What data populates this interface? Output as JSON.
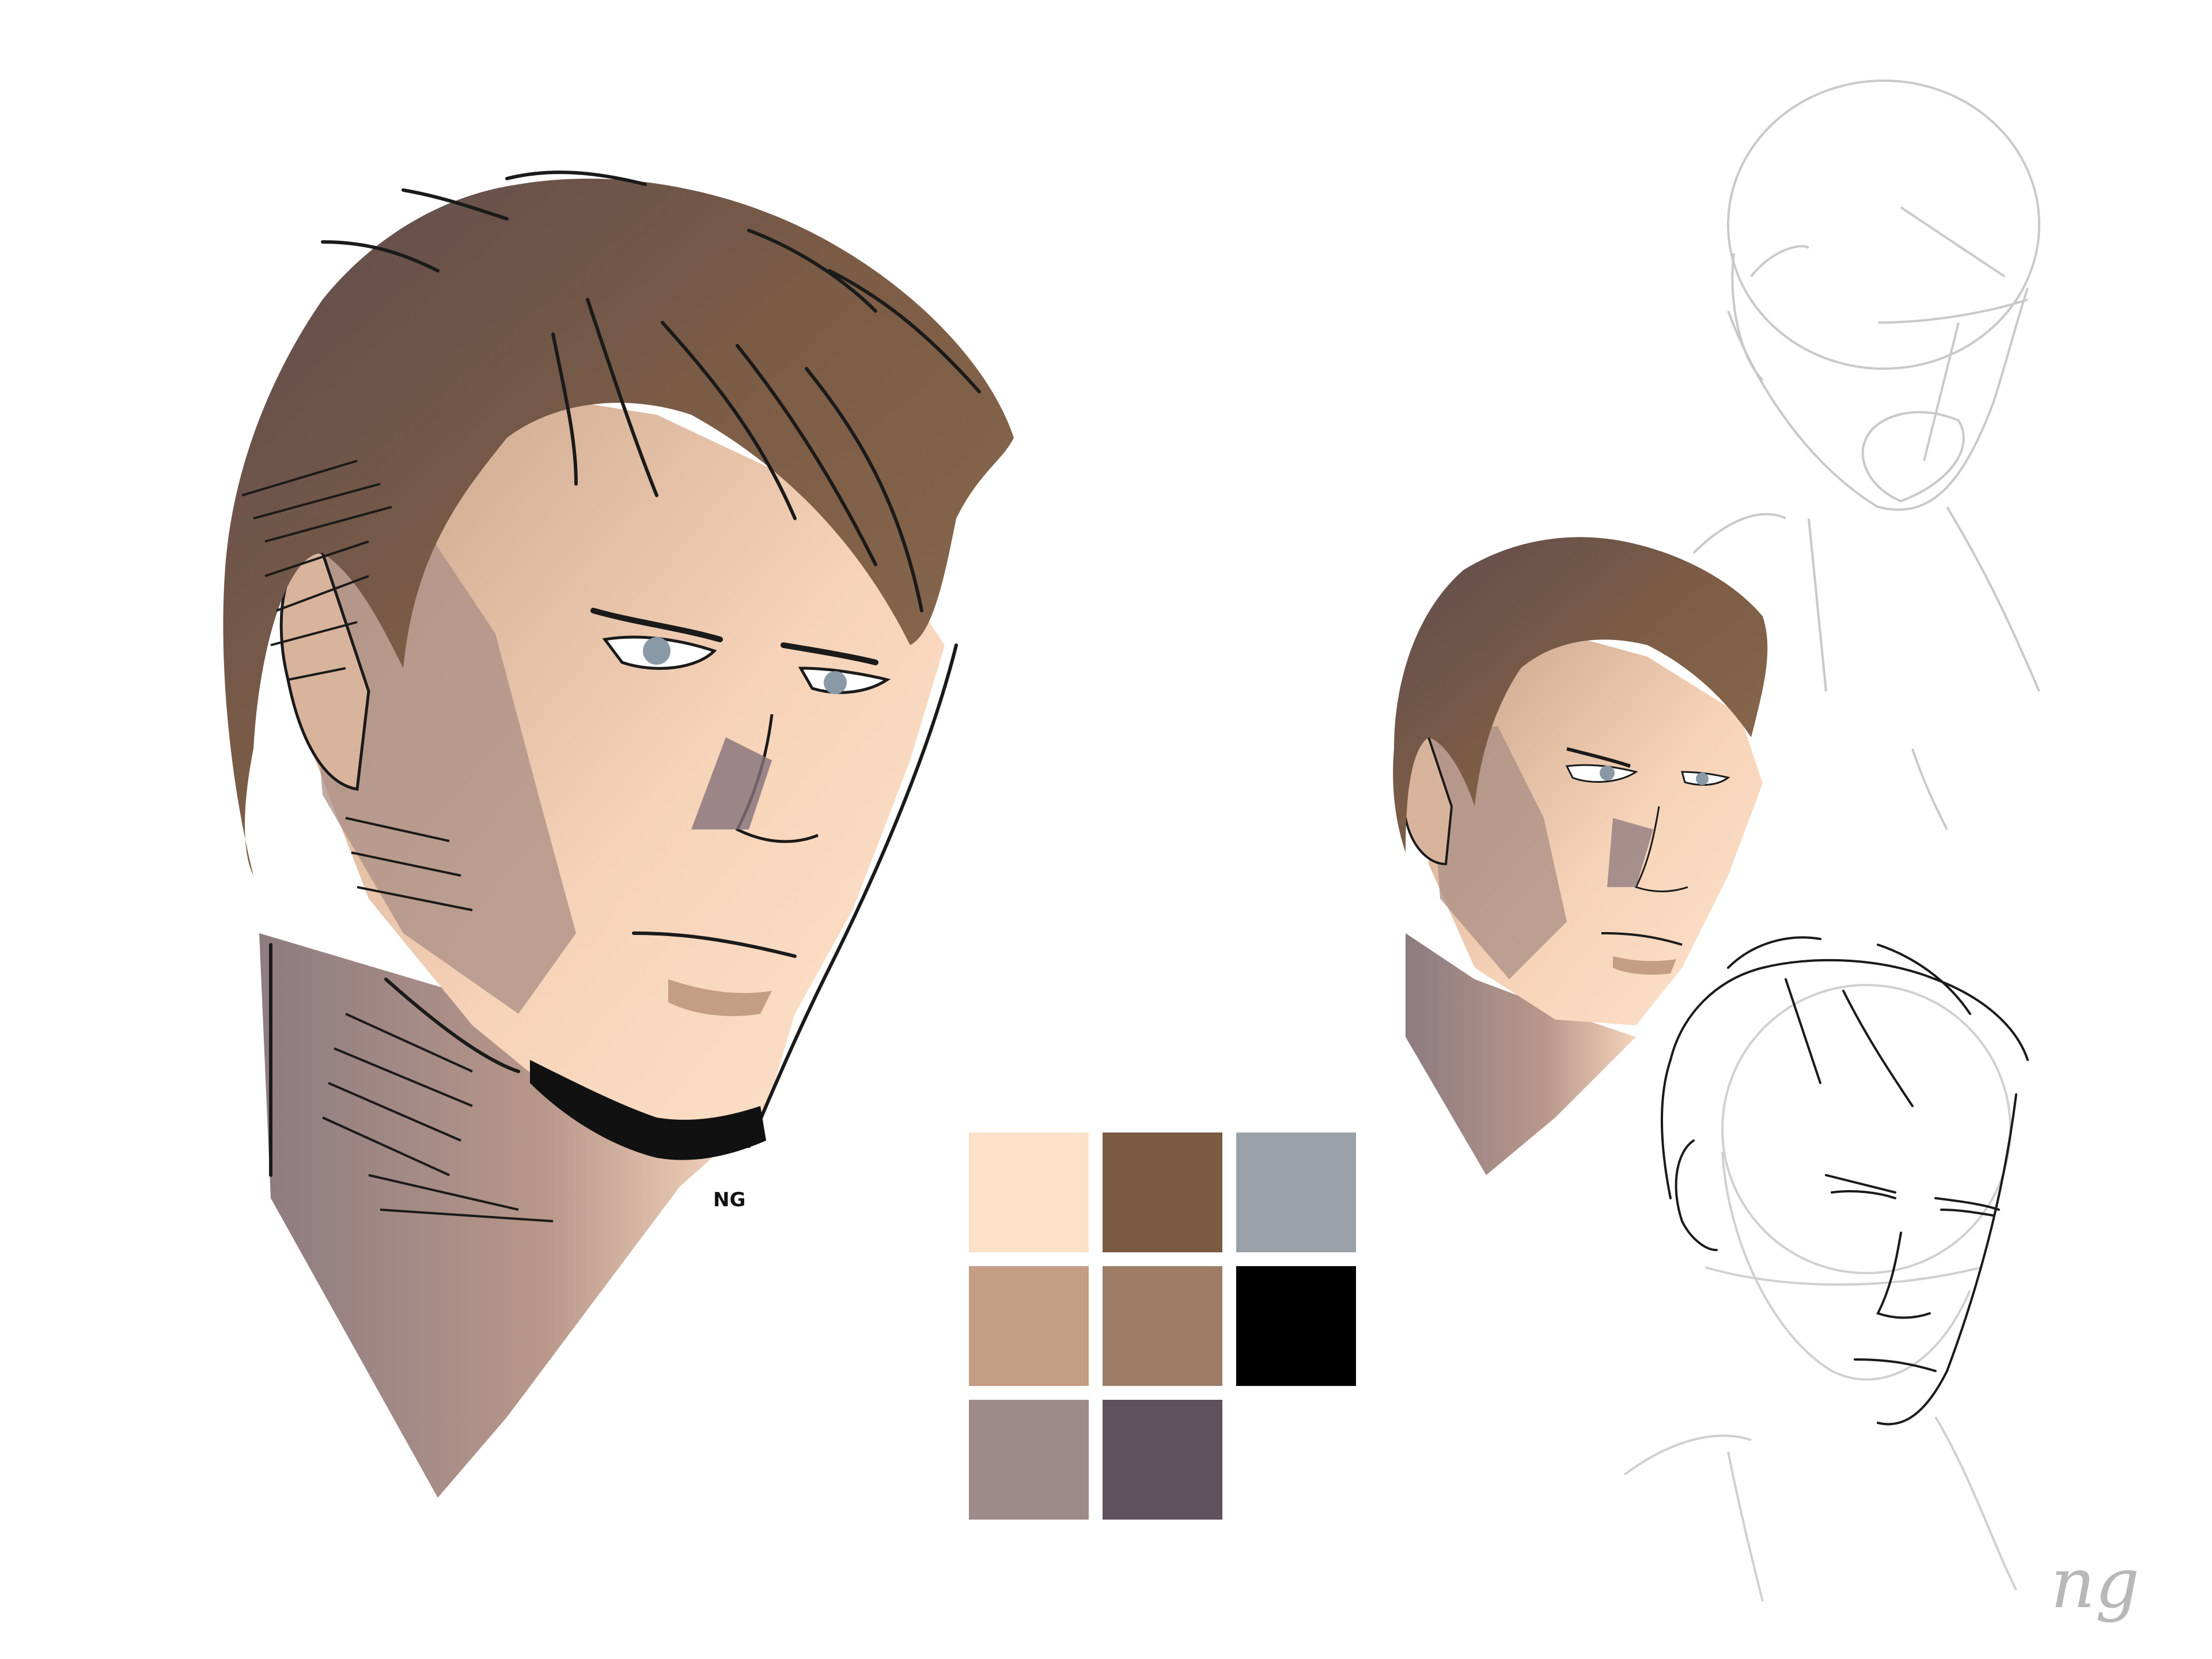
{
  "artwork": {
    "signature_large": "NG",
    "signature_corner": "ng"
  },
  "palette": {
    "swatches": [
      {
        "name": "skin-light",
        "color": "#fde0c8"
      },
      {
        "name": "hair-brown",
        "color": "#7b5a42"
      },
      {
        "name": "eye-gray",
        "color": "#9aa1a9"
      },
      {
        "name": "skin-mid",
        "color": "#c39d84"
      },
      {
        "name": "skin-shadow",
        "color": "#9c7c66"
      },
      {
        "name": "ink-black",
        "color": "#000000"
      },
      {
        "name": "mauve-shadow",
        "color": "#9f8a8a"
      },
      {
        "name": "deep-shadow",
        "color": "#5f525c"
      }
    ]
  },
  "colors": {
    "background": "#ffffff",
    "sketch_line": "#c9c9c9",
    "ink_line": "#1a1a1a"
  }
}
